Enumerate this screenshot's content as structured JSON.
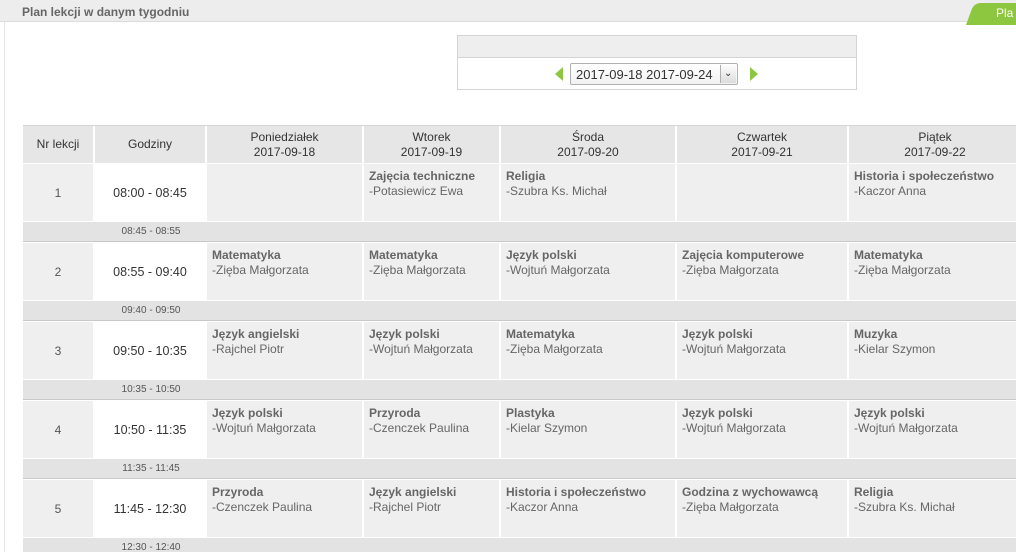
{
  "header": {
    "title": "Plan lekcji w danym tygodniu",
    "tab_label": "Pla"
  },
  "week_selector": {
    "value": "2017-09-18 2017-09-24",
    "prev_icon": "triangle-left",
    "next_icon": "triangle-right"
  },
  "colors": {
    "accent": "#8dc63f",
    "header_bg": "#e6e6e6",
    "cell_bg": "#efefef"
  },
  "table": {
    "col_lesson": "Nr lekcji",
    "col_hours": "Godziny",
    "days": [
      {
        "name": "Poniedziałek",
        "date": "2017-09-18"
      },
      {
        "name": "Wtorek",
        "date": "2017-09-19"
      },
      {
        "name": "Środa",
        "date": "2017-09-20"
      },
      {
        "name": "Czwartek",
        "date": "2017-09-21"
      },
      {
        "name": "Piątek",
        "date": "2017-09-22"
      }
    ],
    "lessons": [
      {
        "nr": "1",
        "time": "08:00 - 08:45",
        "break": "08:45 - 08:55",
        "slots": [
          {
            "subject": "",
            "teacher": ""
          },
          {
            "subject": "Zajęcia techniczne",
            "teacher": "-Potasiewicz Ewa"
          },
          {
            "subject": "Religia",
            "teacher": "-Szubra Ks. Michał"
          },
          {
            "subject": "",
            "teacher": ""
          },
          {
            "subject": "Historia i społeczeństwo",
            "teacher": "-Kaczor Anna"
          }
        ]
      },
      {
        "nr": "2",
        "time": "08:55 - 09:40",
        "break": "09:40 - 09:50",
        "slots": [
          {
            "subject": "Matematyka",
            "teacher": "-Zięba Małgorzata"
          },
          {
            "subject": "Matematyka",
            "teacher": "-Zięba Małgorzata"
          },
          {
            "subject": "Język polski",
            "teacher": "-Wojtuń Małgorzata"
          },
          {
            "subject": "Zajęcia komputerowe",
            "teacher": "-Zięba Małgorzata"
          },
          {
            "subject": "Matematyka",
            "teacher": "-Zięba Małgorzata"
          }
        ]
      },
      {
        "nr": "3",
        "time": "09:50 - 10:35",
        "break": "10:35 - 10:50",
        "slots": [
          {
            "subject": "Język angielski",
            "teacher": "-Rajchel Piotr"
          },
          {
            "subject": "Język polski",
            "teacher": "-Wojtuń Małgorzata"
          },
          {
            "subject": "Matematyka",
            "teacher": "-Zięba Małgorzata"
          },
          {
            "subject": "Język polski",
            "teacher": "-Wojtuń Małgorzata"
          },
          {
            "subject": "Muzyka",
            "teacher": "-Kielar Szymon"
          }
        ]
      },
      {
        "nr": "4",
        "time": "10:50 - 11:35",
        "break": "11:35 - 11:45",
        "slots": [
          {
            "subject": "Język polski",
            "teacher": "-Wojtuń Małgorzata"
          },
          {
            "subject": "Przyroda",
            "teacher": "-Czenczek Paulina"
          },
          {
            "subject": "Plastyka",
            "teacher": "-Kielar Szymon"
          },
          {
            "subject": "Język polski",
            "teacher": "-Wojtuń Małgorzata"
          },
          {
            "subject": "Język polski",
            "teacher": "-Wojtuń Małgorzata"
          }
        ]
      },
      {
        "nr": "5",
        "time": "11:45 - 12:30",
        "break": "12:30 - 12:40",
        "slots": [
          {
            "subject": "Przyroda",
            "teacher": "-Czenczek Paulina"
          },
          {
            "subject": "Język angielski",
            "teacher": "-Rajchel Piotr"
          },
          {
            "subject": "Historia i społeczeństwo",
            "teacher": "-Kaczor Anna"
          },
          {
            "subject": "Godzina z wychowawcą",
            "teacher": "-Zięba Małgorzata"
          },
          {
            "subject": "Religia",
            "teacher": "-Szubra Ks. Michał"
          }
        ]
      }
    ]
  }
}
